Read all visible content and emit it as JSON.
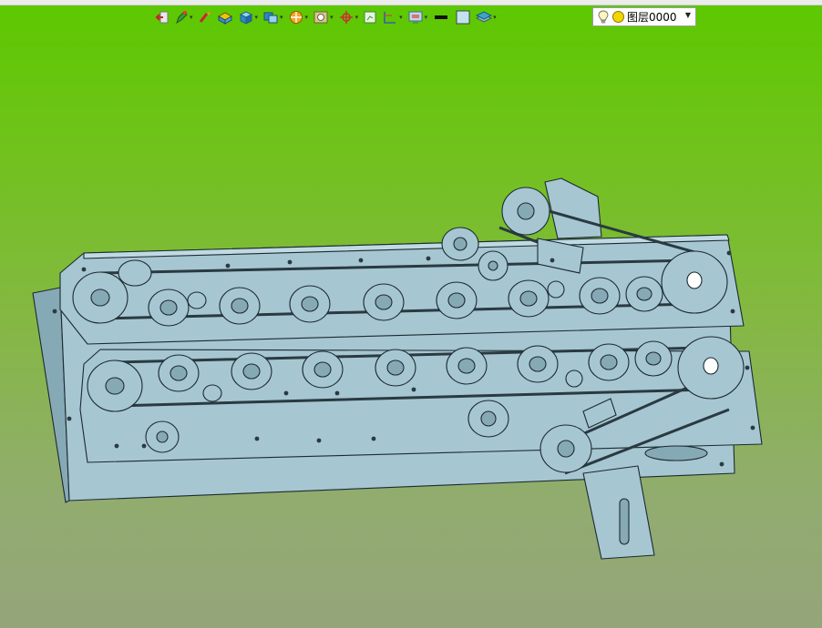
{
  "toolbar": {
    "tools": [
      {
        "icon": "exit-icon",
        "dropdown": false
      },
      {
        "icon": "pen-icon",
        "dropdown": true
      },
      {
        "icon": "brush-icon",
        "dropdown": false
      },
      {
        "icon": "box-yellow-icon",
        "dropdown": false
      },
      {
        "icon": "cube-icon",
        "dropdown": true
      },
      {
        "icon": "view-icon",
        "dropdown": true
      },
      {
        "icon": "section-icon",
        "dropdown": true
      },
      {
        "icon": "frame-icon",
        "dropdown": true
      },
      {
        "icon": "axis-icon",
        "dropdown": true
      },
      {
        "icon": "pane-icon",
        "dropdown": false
      },
      {
        "icon": "dimension-icon",
        "dropdown": true
      },
      {
        "icon": "screen-icon",
        "dropdown": true
      },
      {
        "icon": "line-weight-icon",
        "dropdown": false
      },
      {
        "icon": "fill-color-icon",
        "dropdown": false
      },
      {
        "icon": "layers-icon",
        "dropdown": true
      }
    ],
    "layer": {
      "name": "图层0000",
      "bulb_icon": "lightbulb-icon",
      "color_icon": "layer-color-icon",
      "color": "#f2d600"
    }
  },
  "colors": {
    "part": "#a6c6d2",
    "part_dark": "#86a9b6",
    "edge": "#1c2a30",
    "bg_top": "#5cc800",
    "bg_bottom": "#94a57a"
  }
}
